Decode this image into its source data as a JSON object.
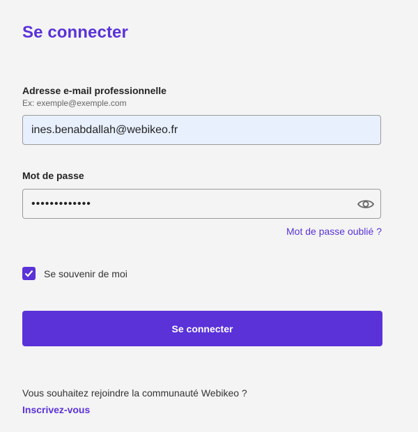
{
  "login": {
    "title": "Se connecter",
    "email": {
      "label": "Adresse e-mail professionnelle",
      "hint": "Ex: exemple@exemple.com",
      "value": "ines.benabdallah@webikeo.fr"
    },
    "password": {
      "label": "Mot de passe",
      "value_masked": "•••••••••••••",
      "toggle_icon": "eye-icon"
    },
    "forgot_password": "Mot de passe oublié ?",
    "remember_me": {
      "label": "Se souvenir de moi",
      "checked": true
    },
    "submit_label": "Se connecter",
    "join_prompt": "Vous souhaitez rejoindre la communauté Webikeo ?",
    "signup_link": "Inscrivez-vous"
  },
  "colors": {
    "accent": "#5a32d8",
    "background": "#f4f4f4",
    "autofill": "#e8f0fe"
  }
}
